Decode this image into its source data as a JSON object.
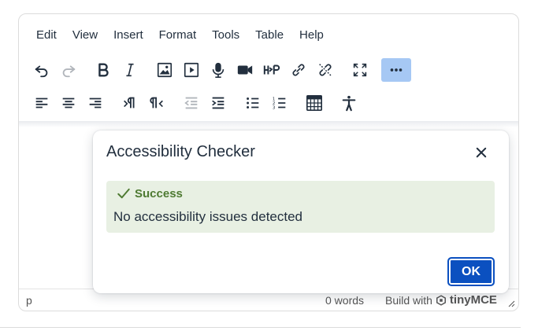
{
  "menubar": {
    "items": [
      "Edit",
      "View",
      "Insert",
      "Format",
      "Tools",
      "Table",
      "Help"
    ]
  },
  "toolbar": {
    "row1": [
      "undo-icon",
      "redo-icon",
      "bold-icon",
      "italic-icon",
      "image-icon",
      "media-icon",
      "microphone-icon",
      "video-camera-icon",
      "h5p-icon",
      "link-icon",
      "unlink-icon",
      "fullscreen-icon",
      "more-icon"
    ],
    "row2": [
      "align-left-icon",
      "align-center-icon",
      "align-right-icon",
      "ltr-icon",
      "rtl-icon",
      "outdent-icon",
      "indent-icon",
      "bullet-list-icon",
      "numbered-list-icon",
      "table-icon",
      "accessibility-icon"
    ],
    "active": "more-icon",
    "disabled": [
      "redo-icon",
      "outdent-icon"
    ]
  },
  "statusbar": {
    "path": "p",
    "word_count": "0 words",
    "brand_prefix": "Build with",
    "brand_name": "tinyMCE"
  },
  "dialog": {
    "title": "Accessibility Checker",
    "success_heading": "Success",
    "success_message": "No accessibility issues detected",
    "ok_label": "OK"
  },
  "colors": {
    "accent": "#0b50c0",
    "active_button": "#a6c8f4",
    "success_bg": "#e8f0e3",
    "success_text": "#4e7a32"
  }
}
